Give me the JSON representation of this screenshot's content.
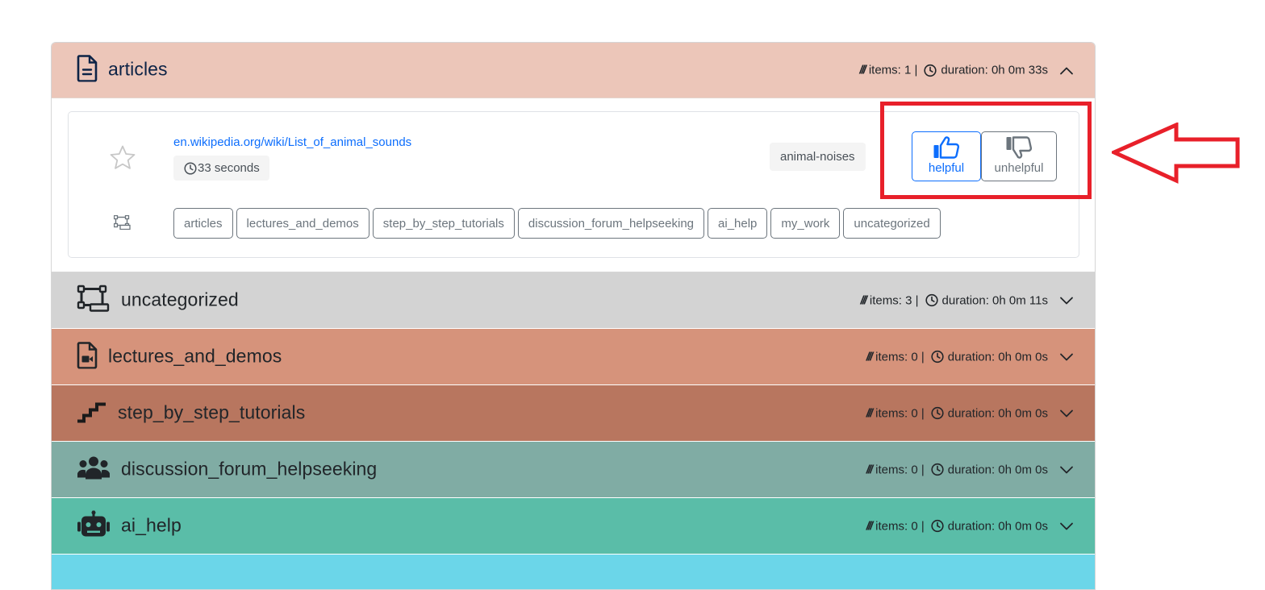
{
  "sections": [
    {
      "title": "articles",
      "icon": "document-icon",
      "items_label": "items: 1 |",
      "duration_label": "duration: 0h 0m 33s",
      "color": "#ecc6b9",
      "expanded": true
    },
    {
      "title": "uncategorized",
      "icon": "shapes-icon",
      "items_label": "items: 3 |",
      "duration_label": "duration: 0h 0m 11s",
      "color": "#d3d3d3",
      "expanded": false
    },
    {
      "title": "lectures_and_demos",
      "icon": "video-file-icon",
      "items_label": "items: 0 |",
      "duration_label": "duration: 0h 0m 0s",
      "color": "#d6937b",
      "expanded": false
    },
    {
      "title": "step_by_step_tutorials",
      "icon": "stairs-icon",
      "items_label": "items: 0 |",
      "duration_label": "duration: 0h 0m 0s",
      "color": "#b8765f",
      "expanded": false
    },
    {
      "title": "discussion_forum_helpseeking",
      "icon": "people-icon",
      "items_label": "items: 0 |",
      "duration_label": "duration: 0h 0m 0s",
      "color": "#80aca4",
      "expanded": false
    },
    {
      "title": "ai_help",
      "icon": "robot-icon",
      "items_label": "items: 0 |",
      "duration_label": "duration: 0h 0m 0s",
      "color": "#5abda8",
      "expanded": false
    },
    {
      "title": "",
      "icon": "",
      "color": "#6bd6e9",
      "expanded": false
    }
  ],
  "item": {
    "url": "en.wikipedia.org/wiki/List_of_animal_sounds",
    "duration": "33 seconds",
    "tag": "animal-noises",
    "helpful_label": "helpful",
    "unhelpful_label": "unhelpful",
    "categories": [
      "articles",
      "lectures_and_demos",
      "step_by_step_tutorials",
      "discussion_forum_helpseeking",
      "ai_help",
      "my_work",
      "uncategorized"
    ]
  },
  "annotation_color": "#e8202a"
}
